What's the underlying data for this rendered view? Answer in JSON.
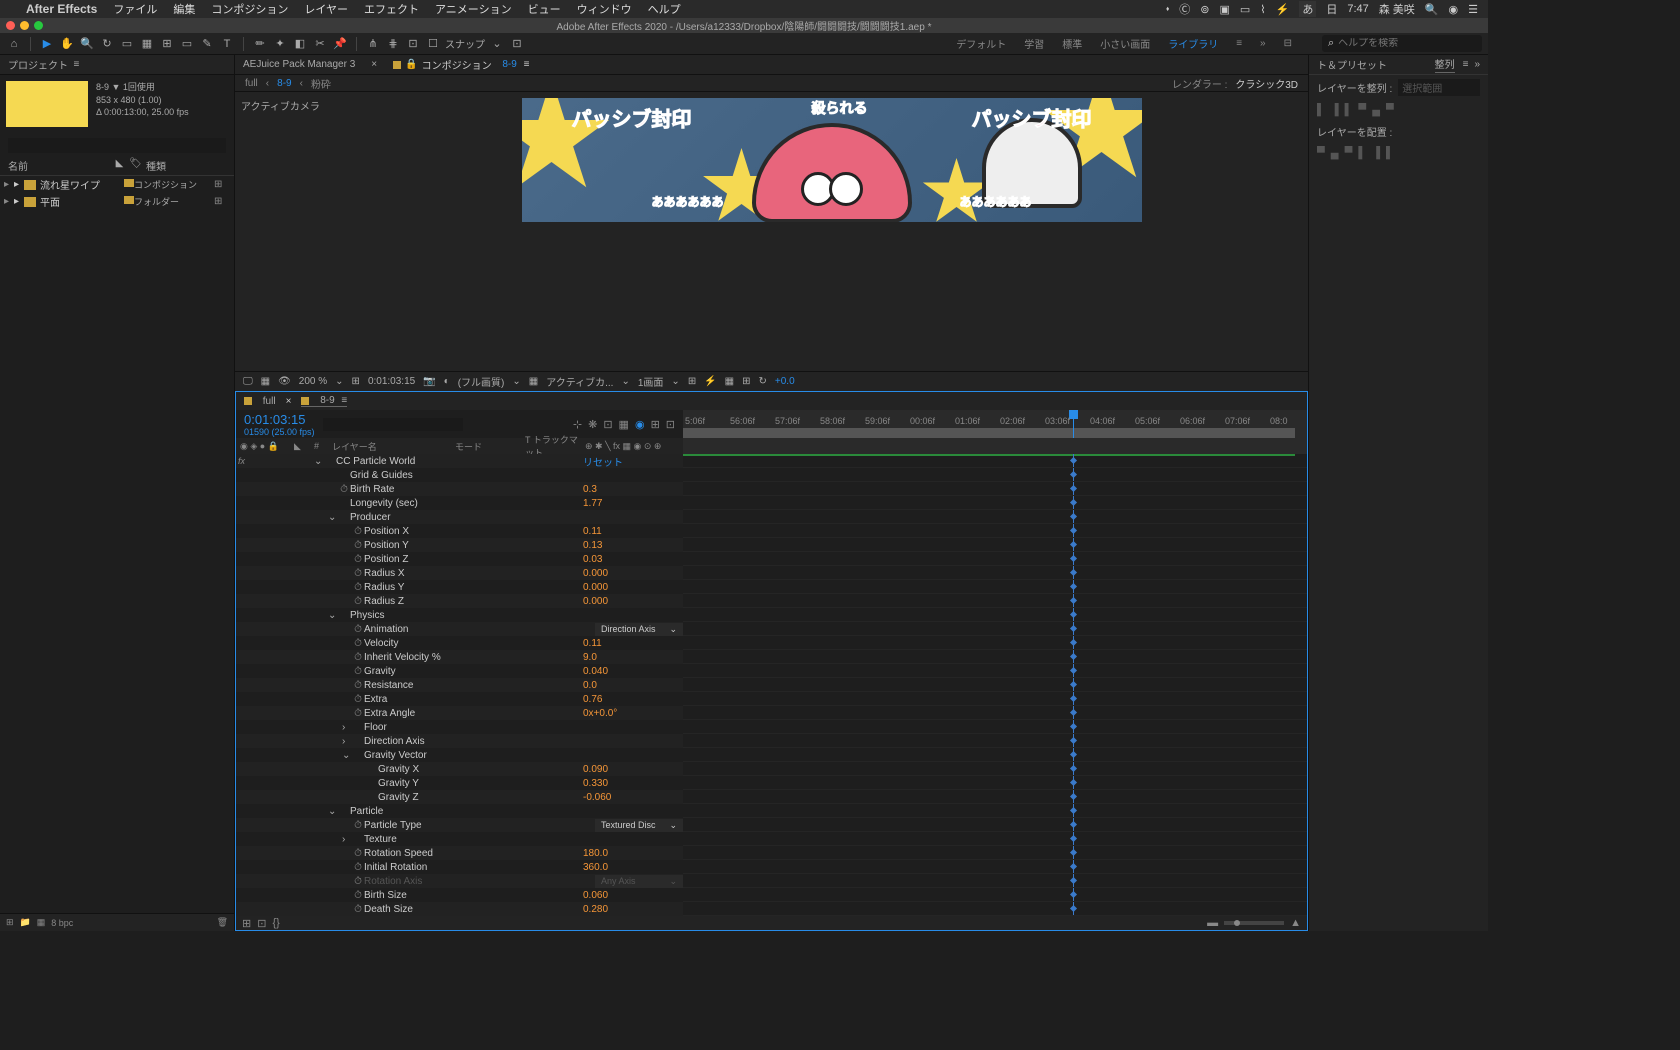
{
  "menubar": {
    "appname": "After Effects",
    "items": [
      "ファイル",
      "編集",
      "コンポジション",
      "レイヤー",
      "エフェクト",
      "アニメーション",
      "ビュー",
      "ウィンドウ",
      "ヘルプ"
    ],
    "right": {
      "ime": "あ",
      "day": "日",
      "time": "7:47",
      "user": "森 美咲"
    }
  },
  "titlebar": "Adobe After Effects 2020 - /Users/a12333/Dropbox/陰陽師/闘闘闘技/闘闘闘技1.aep *",
  "toolbar": {
    "snap": "スナップ",
    "workspaces": [
      "デフォルト",
      "学習",
      "標準",
      "小さい画面",
      "ライブラリ"
    ],
    "active_ws": 4,
    "search_ph": "ヘルプを検索"
  },
  "project": {
    "title": "プロジェクト",
    "meta": {
      "name": "8-9 ▼  1回使用",
      "dims": "853 x 480 (1.00)",
      "dur": "Δ 0:00:13:00, 25.00 fps"
    },
    "search_ph": "",
    "cols": {
      "name": "名前",
      "type": "種類"
    },
    "rows": [
      {
        "arw": "▸",
        "label": "流れ星ワイプ",
        "type": "コンポジション",
        "ico": "comp"
      },
      {
        "arw": "▸",
        "label": "平面",
        "type": "フォルダー",
        "ico": "folder"
      }
    ],
    "bpc": "8 bpc"
  },
  "comp": {
    "tabs": [
      "AEJuice Pack Manager 3",
      "コンポジション"
    ],
    "comp_link": "8-9",
    "crumbs": [
      "full",
      "8-9",
      "粉砕"
    ],
    "render_lbl": "レンダラー :",
    "render_val": "クラシック3D",
    "side": "アクティブカメラ",
    "canvas_txt": {
      "l": "パッシブ封印",
      "r": "パッシブ封印",
      "c": "殺られる",
      "sub": "ああああああ"
    },
    "btm": {
      "zoom": "200 %",
      "tc": "0:01:03:15",
      "res": "(フル画質)",
      "cam": "アクティブカ...",
      "view": "1画面",
      "px": "+0.0"
    }
  },
  "timeline": {
    "tabs": [
      "full",
      "8-9"
    ],
    "tc": "0:01:03:15",
    "frames": "01590 (25.00 fps)",
    "search_ph": "",
    "cols": {
      "name": "レイヤー名",
      "mode": "モード",
      "trk": "T  トラックマット"
    },
    "ticks": [
      "5:06f",
      "56:06f",
      "57:06f",
      "58:06f",
      "59:06f",
      "00:06f",
      "01:06f",
      "02:06f",
      "03:06f",
      "04:06f",
      "05:06f",
      "06:06f",
      "07:06f",
      "08:0"
    ],
    "rows": [
      {
        "ind": 1,
        "arw": "⌄",
        "name": "CC Particle World",
        "val": "リセット",
        "valclass": "reset",
        "fx": true
      },
      {
        "ind": 2,
        "name": "Grid & Guides"
      },
      {
        "ind": 2,
        "sw": "⏱",
        "name": "Birth Rate",
        "val": "0.3"
      },
      {
        "ind": 2,
        "name": "Longevity (sec)",
        "val": "1.77"
      },
      {
        "ind": 2,
        "arw": "⌄",
        "name": "Producer"
      },
      {
        "ind": 3,
        "sw": "⏱",
        "name": "Position X",
        "val": "0.11"
      },
      {
        "ind": 3,
        "sw": "⏱",
        "name": "Position Y",
        "val": "0.13"
      },
      {
        "ind": 3,
        "sw": "⏱",
        "name": "Position Z",
        "val": "0.03"
      },
      {
        "ind": 3,
        "sw": "⏱",
        "name": "Radius X",
        "val": "0.000"
      },
      {
        "ind": 3,
        "sw": "⏱",
        "name": "Radius Y",
        "val": "0.000"
      },
      {
        "ind": 3,
        "sw": "⏱",
        "name": "Radius Z",
        "val": "0.000"
      },
      {
        "ind": 2,
        "arw": "⌄",
        "name": "Physics"
      },
      {
        "ind": 3,
        "sw": "⏱",
        "name": "Animation",
        "dd": "Direction Axis"
      },
      {
        "ind": 3,
        "sw": "⏱",
        "name": "Velocity",
        "val": "0.11"
      },
      {
        "ind": 3,
        "sw": "⏱",
        "name": "Inherit Velocity %",
        "val": "9.0"
      },
      {
        "ind": 3,
        "sw": "⏱",
        "name": "Gravity",
        "val": "0.040"
      },
      {
        "ind": 3,
        "sw": "⏱",
        "name": "Resistance",
        "val": "0.0"
      },
      {
        "ind": 3,
        "sw": "⏱",
        "name": "Extra",
        "val": "0.76"
      },
      {
        "ind": 3,
        "sw": "⏱",
        "name": "Extra Angle",
        "val": "0x+0.0°"
      },
      {
        "ind": 3,
        "arw": "›",
        "name": "Floor"
      },
      {
        "ind": 3,
        "arw": "›",
        "name": "Direction Axis"
      },
      {
        "ind": 3,
        "arw": "⌄",
        "name": "Gravity Vector"
      },
      {
        "ind": 4,
        "name": "Gravity X",
        "val": "0.090"
      },
      {
        "ind": 4,
        "name": "Gravity Y",
        "val": "0.330"
      },
      {
        "ind": 4,
        "name": "Gravity Z",
        "val": "-0.060"
      },
      {
        "ind": 2,
        "arw": "⌄",
        "name": "Particle"
      },
      {
        "ind": 3,
        "sw": "⏱",
        "name": "Particle Type",
        "dd": "Textured Disc"
      },
      {
        "ind": 3,
        "arw": "›",
        "name": "Texture"
      },
      {
        "ind": 3,
        "sw": "⏱",
        "name": "Rotation Speed",
        "val": "180.0"
      },
      {
        "ind": 3,
        "sw": "⏱",
        "name": "Initial Rotation",
        "val": "360.0"
      },
      {
        "ind": 3,
        "sw": "⏱",
        "name": "Rotation Axis",
        "dd": "Any Axis",
        "dim": true
      },
      {
        "ind": 3,
        "sw": "⏱",
        "name": "Birth Size",
        "val": "0.060"
      },
      {
        "ind": 3,
        "sw": "⏱",
        "name": "Death Size",
        "val": "0.280"
      }
    ]
  },
  "right": {
    "hdr1": "ト＆プリセット",
    "hdr1b": "整列",
    "align_lbl": "レイヤーを整列 :",
    "align_val": "選択範囲",
    "dist_lbl": "レイヤーを配置 :"
  }
}
